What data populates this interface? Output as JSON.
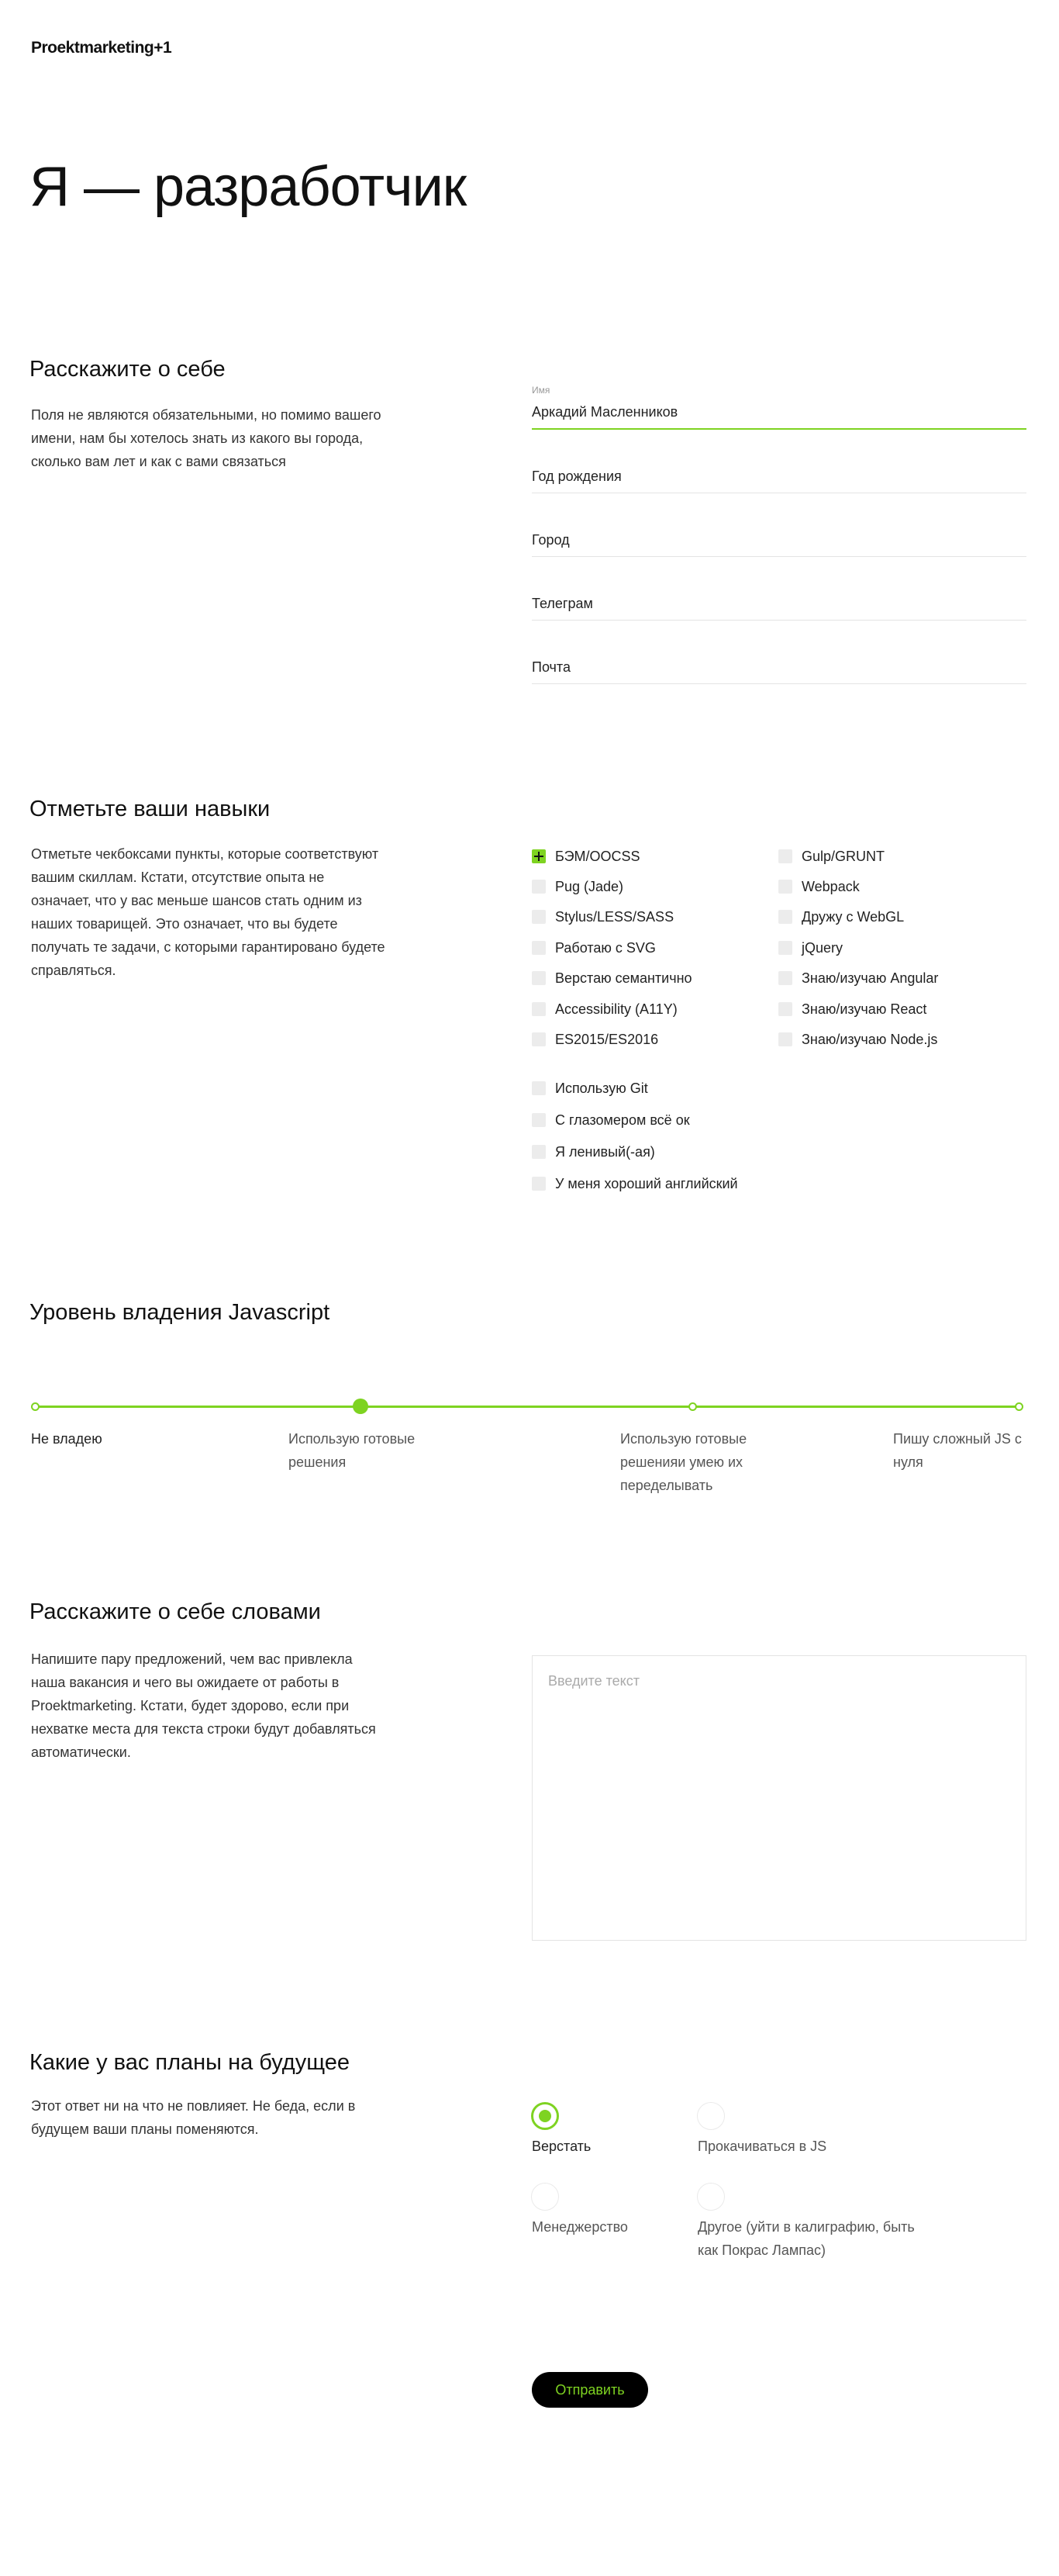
{
  "logo": "Proektmarketing+1",
  "hero_title": "Я — разработчик",
  "about": {
    "title": "Расскажите о себе",
    "description": "Поля не являются обязательными, но помимо вашего имени, нам бы хотелось знать из какого вы города, сколько вам лет и как с вами связаться",
    "name_label": "Имя",
    "name_value": "Аркадий Масленников",
    "birth_year": "Год рождения",
    "city": "Город",
    "telegram": "Телеграм",
    "email": "Почта"
  },
  "skills": {
    "title": "Отметьте ваши навыки",
    "description": "Отметьте чекбоксами пункты, которые соответствуют вашим скиллам. Кстати, отсутствие опыта не означает, что у вас меньше шансов стать одним из наших товарищей. Это означает, что вы будете получать те задачи, с которыми гарантировано будете справляться.",
    "left_column": [
      "БЭМ/OOCSS",
      "Pug (Jade)",
      "Stylus/LESS/SASS",
      "Работаю с SVG",
      "Верстаю семантично",
      "Accessibility (A11Y)",
      "ES2015/ES2016"
    ],
    "right_column": [
      "Gulp/GRUNT",
      "Webpack",
      "Дружу с WebGL",
      "jQuery",
      "Знаю/изучаю Angular",
      "Знаю/изучаю React",
      "Знаю/изучаю Node.js"
    ],
    "bottom_group": [
      "Использую Git",
      "С глазомером всё ок",
      "Я ленивый(-ая)",
      "У меня хороший английский"
    ],
    "checked": [
      "БЭМ/OOCSS"
    ]
  },
  "js_level": {
    "title": "Уровень владения Javascript",
    "levels": [
      "Не владею",
      "Использую готовые решения",
      "Использую готовые решенияи умею их переделывать",
      "Пишу сложный JS с нуля"
    ],
    "selected_index": 1
  },
  "about_words": {
    "title": "Расскажите о себе словами",
    "description": "Напишите пару предложений, чем вас привлекла наша вакансия и чего вы ожидаете от работы в Proektmarketing. Кстати, будет здорово, если при нехватке места для текста строки будут добавляться автоматически.",
    "placeholder": "Введите текст"
  },
  "plans": {
    "title": "Какие у вас планы на будущее",
    "description": "Этот ответ ни на что не повлияет. Не беда, если в будущем ваши планы поменяются.",
    "options": [
      "Верстать",
      "Прокачиваться в JS",
      "Менеджерство",
      "Другое (уйти в калиграфию, быть как Покрас Лампас)"
    ],
    "selected": "Верстать"
  },
  "submit_label": "Отправить",
  "colors": {
    "accent": "#7ed321",
    "button_bg": "#000000"
  }
}
